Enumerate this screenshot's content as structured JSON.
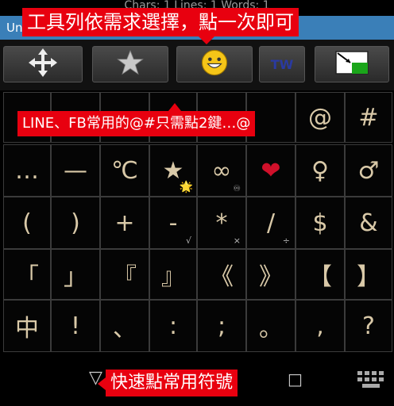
{
  "status": {
    "text": "Chars: 1 Lines: 1 Words: 1"
  },
  "titlebar": {
    "app_name": "Un"
  },
  "toolbar": {
    "buttons": [
      {
        "icon": "move-arrows-icon"
      },
      {
        "icon": "star-icon"
      },
      {
        "icon": "smiley-icon"
      },
      {
        "label": "TW"
      },
      {
        "icon": "flag-screen-icon"
      }
    ]
  },
  "grid": {
    "rows": [
      [
        {
          "main": "~"
        },
        {
          "main": ""
        },
        {
          "main": ""
        },
        {
          "main": ""
        },
        {
          "main": ""
        },
        {
          "main": ""
        },
        {
          "main": "@"
        },
        {
          "main": "#"
        }
      ],
      [
        {
          "main": "…"
        },
        {
          "main": "—"
        },
        {
          "main": "℃"
        },
        {
          "main": "★",
          "sub": "🌟"
        },
        {
          "main": "∞",
          "sub": "♾"
        },
        {
          "main": "❤"
        },
        {
          "main": "♀"
        },
        {
          "main": "♂"
        }
      ],
      [
        {
          "main": "("
        },
        {
          "main": ")"
        },
        {
          "main": "+"
        },
        {
          "main": "-",
          "sub": "√"
        },
        {
          "main": "*",
          "sub": "×"
        },
        {
          "main": "/",
          "sub": "÷"
        },
        {
          "main": "$"
        },
        {
          "main": "&"
        }
      ],
      [
        {
          "main": "「"
        },
        {
          "main": "」"
        },
        {
          "main": "『"
        },
        {
          "main": "』"
        },
        {
          "main": "《"
        },
        {
          "main": "》"
        },
        {
          "main": "【"
        },
        {
          "main": "】"
        }
      ],
      [
        {
          "main": "中"
        },
        {
          "main": "!"
        },
        {
          "main": "、"
        },
        {
          "main": ":"
        },
        {
          "main": ";"
        },
        {
          "main": "。"
        },
        {
          "main": ","
        },
        {
          "main": "?"
        }
      ]
    ]
  },
  "bottombar": {
    "left_symbol": "▽",
    "square_symbol": "□",
    "keyboard_icon": "keyboard-icon"
  },
  "callouts": {
    "top": "工具列依需求選擇，點一次即可",
    "middle": "LINE、FB常用的@#只需點2鍵…@",
    "bottom": "快速點常用符號"
  },
  "colors": {
    "titlebar": "#3a7fb8",
    "callout": "#e8000f",
    "key_text": "#d9c9a8",
    "heart": "#d0102a"
  }
}
